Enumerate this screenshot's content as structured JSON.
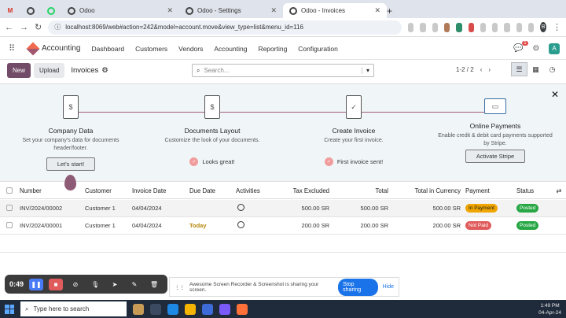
{
  "browser": {
    "tabs": [
      {
        "label": "",
        "icon": "gmail-icon"
      },
      {
        "label": "",
        "icon": "chrome-icon"
      },
      {
        "label": "",
        "icon": "whatsapp-icon"
      },
      {
        "label": "Odoo",
        "icon": "odoo-icon"
      },
      {
        "label": "Odoo - Settings",
        "icon": "odoo-icon"
      },
      {
        "label": "Odoo - Invoices",
        "icon": "odoo-icon"
      }
    ],
    "url": "localhost:8069/web#action=242&model=account.move&view_type=list&menu_id=116",
    "profile_initial": "B"
  },
  "odoo": {
    "app_name": "Accounting",
    "menu": [
      "Dashboard",
      "Customers",
      "Vendors",
      "Accounting",
      "Reporting",
      "Configuration"
    ],
    "user_initial": "A",
    "notification_count": "1",
    "new_label": "New",
    "upload_label": "Upload",
    "breadcrumb": "Invoices",
    "search_placeholder": "Search...",
    "pager": "1-2 / 2"
  },
  "onboarding": {
    "steps": [
      {
        "title": "Company Data",
        "desc": "Set your company's data for documents header/footer.",
        "action": "Let's start!",
        "done": false
      },
      {
        "title": "Documents Layout",
        "desc": "Customize the look of your documents.",
        "action": "Looks great!",
        "done": true
      },
      {
        "title": "Create Invoice",
        "desc": "Create your first invoice.",
        "action": "First invoice sent!",
        "done": true
      },
      {
        "title": "Online Payments",
        "desc": "Enable credit & debit card payments supported by Stripe.",
        "action": "Activate Stripe",
        "done": false
      }
    ]
  },
  "table": {
    "headers": [
      "Number",
      "Customer",
      "Invoice Date",
      "Due Date",
      "Activities",
      "Tax Excluded",
      "Total",
      "Total in Currency",
      "Payment",
      "Status"
    ],
    "rows": [
      {
        "number": "INV/2024/00002",
        "customer": "Customer 1",
        "invoice_date": "04/04/2024",
        "due_date": "",
        "tax_excluded": "500.00 SR",
        "total": "500.00 SR",
        "total_currency": "500.00 SR",
        "payment": "In Payment",
        "payment_color": "#f0a500",
        "status": "Posted",
        "status_color": "#28a745"
      },
      {
        "number": "INV/2024/00001",
        "customer": "Customer 1",
        "invoice_date": "04/04/2024",
        "due_date": "Today",
        "tax_excluded": "200.00 SR",
        "total": "200.00 SR",
        "total_currency": "200.00 SR",
        "payment": "Not Paid",
        "payment_color": "#e05b5b",
        "status": "Posted",
        "status_color": "#28a745"
      }
    ]
  },
  "recorder": {
    "time": "0:49",
    "share_text": "Awesome Screen Recorder & Screenshot is sharing your screen.",
    "stop_label": "Stop sharing",
    "hide_label": "Hide"
  },
  "taskbar": {
    "search_placeholder": "Type here to search",
    "time": "1:49 PM",
    "date": "04-Apr-24"
  }
}
